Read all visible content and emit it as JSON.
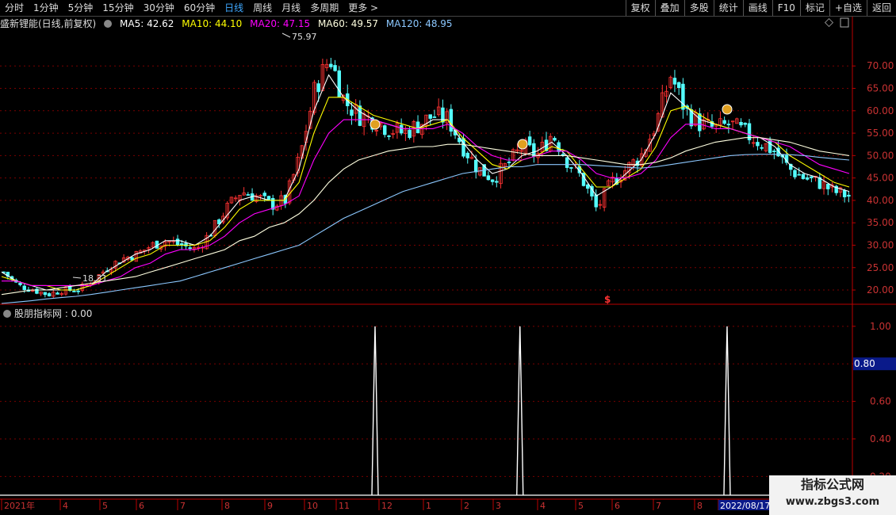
{
  "toolbar": {
    "left": [
      "分时",
      "1分钟",
      "5分钟",
      "15分钟",
      "30分钟",
      "60分钟",
      "日线",
      "周线",
      "月线",
      "多周期",
      "更多 >"
    ],
    "active": "日线",
    "right": [
      "复权",
      "叠加",
      "多股",
      "统计",
      "画线",
      "F10",
      "标记",
      "+自选",
      "返回"
    ]
  },
  "title": {
    "stock": "盛新锂能(日线,前复权)",
    "ma5": "MA5: 42.62",
    "ma10": "MA10: 44.10",
    "ma20": "MA20: 47.15",
    "ma60": "MA60: 49.57",
    "ma120": "MA120: 48.95"
  },
  "colors": {
    "up": "#ff3232",
    "down": "#54ffff",
    "ma5": "#ffffff",
    "ma10": "#ffff00",
    "ma20": "#ff00ff",
    "ma60": "#ffffe0",
    "ma120": "#8cc8ff",
    "grid": "#7a0000",
    "axis_text": "#c83232"
  },
  "indicator": {
    "label": "股朋指标网 : 0.00"
  },
  "watermark": {
    "line1": "指标公式网",
    "line2": "www.zbgs3.com"
  },
  "chart_data": [
    {
      "type": "candlestick",
      "title": "盛新锂能(日线,前复权)",
      "ylim": [
        17,
        78
      ],
      "yticks": [
        "70.00",
        "65.00",
        "60.00",
        "55.00",
        "50.00",
        "45.00",
        "40.00",
        "35.00",
        "30.00",
        "25.00",
        "20.00"
      ],
      "max_label": "75.97",
      "min_label": "18.31",
      "x_labels": [
        "2021年",
        "4",
        "5",
        "6",
        "7",
        "8",
        "9",
        "10",
        "11",
        "12",
        "1",
        "2",
        "3",
        "4",
        "5",
        "6",
        "7",
        "8",
        "2022/08/17/"
      ],
      "close_path": [
        24,
        21,
        20,
        19,
        20,
        20,
        22,
        25,
        27,
        28,
        30,
        31,
        30,
        29,
        33,
        38,
        42,
        41,
        39,
        40,
        50,
        65,
        72,
        62,
        59,
        58,
        56,
        55,
        57,
        59,
        58,
        52,
        47,
        45,
        48,
        52,
        50,
        55,
        49,
        45,
        38,
        44,
        47,
        50,
        57,
        68,
        60,
        57,
        56,
        57,
        55,
        53,
        51,
        47,
        45,
        44,
        42,
        41
      ],
      "series": [
        {
          "name": "MA5",
          "values": [
            24,
            22,
            21,
            20,
            20,
            20,
            21,
            24,
            26,
            28,
            29,
            31,
            31,
            30,
            32,
            36,
            40,
            41,
            40,
            40,
            47,
            60,
            68,
            63,
            60,
            58,
            57,
            56,
            56,
            58,
            58,
            53,
            49,
            46,
            47,
            50,
            51,
            53,
            50,
            46,
            41,
            43,
            46,
            49,
            55,
            64,
            61,
            58,
            57,
            56,
            55,
            54,
            52,
            48,
            46,
            45,
            43,
            42
          ]
        },
        {
          "name": "MA10",
          "values": [
            23,
            22,
            21,
            21,
            20,
            20,
            21,
            23,
            25,
            27,
            28,
            30,
            30,
            30,
            31,
            34,
            38,
            40,
            40,
            40,
            44,
            55,
            63,
            63,
            61,
            59,
            58,
            57,
            56,
            57,
            58,
            54,
            51,
            48,
            47,
            49,
            50,
            52,
            51,
            47,
            43,
            43,
            45,
            47,
            52,
            60,
            61,
            59,
            57,
            56,
            55,
            54,
            53,
            50,
            48,
            46,
            44,
            43
          ]
        },
        {
          "name": "MA20",
          "values": [
            22,
            22,
            21,
            21,
            21,
            21,
            21,
            22,
            23,
            25,
            26,
            28,
            29,
            29,
            30,
            32,
            35,
            37,
            38,
            39,
            41,
            49,
            55,
            58,
            58,
            58,
            57,
            56,
            56,
            56,
            57,
            55,
            52,
            50,
            49,
            49,
            50,
            51,
            51,
            49,
            46,
            45,
            45,
            46,
            49,
            54,
            57,
            57,
            56,
            56,
            55,
            54,
            53,
            52,
            50,
            48,
            47,
            46
          ]
        },
        {
          "name": "MA60",
          "values": [
            19,
            19.5,
            20,
            20,
            20.5,
            21,
            21.5,
            22,
            22.5,
            23,
            24,
            25,
            26,
            27,
            28,
            29,
            31,
            32,
            34,
            35,
            37,
            40,
            44,
            47,
            49,
            50,
            51,
            51.5,
            52,
            52,
            52.5,
            52.5,
            52,
            51.5,
            51,
            50.5,
            50,
            50,
            50,
            49.5,
            49,
            48.5,
            48,
            48,
            48.5,
            49.5,
            51,
            52,
            53,
            53.5,
            54,
            54,
            53.5,
            53,
            52,
            51,
            50.5,
            50
          ]
        },
        {
          "name": "MA120",
          "values": [
            17,
            17.3,
            17.6,
            18,
            18.3,
            18.6,
            19,
            19.5,
            20,
            20.5,
            21,
            21.5,
            22,
            23,
            24,
            25,
            26,
            27,
            28,
            29,
            30,
            32,
            34,
            36,
            37.5,
            39,
            40.5,
            42,
            43,
            44,
            45,
            46,
            46.5,
            47,
            47.5,
            47.5,
            48,
            48,
            48,
            48,
            47.8,
            47.6,
            47.4,
            47.2,
            47.5,
            48,
            48.5,
            49,
            49.5,
            50,
            50.2,
            50.3,
            50.3,
            50.2,
            50,
            49.6,
            49.3,
            49
          ]
        }
      ]
    },
    {
      "type": "line",
      "title": "股朋指标网",
      "ylim": [
        0.1,
        1.05
      ],
      "yticks": [
        "1.00",
        "0.80",
        "0.60",
        "0.40",
        "0.20"
      ],
      "highlight": "0.80",
      "spikes_at_fraction": [
        0.44,
        0.61,
        0.853
      ],
      "values_note_value": "0.00"
    }
  ]
}
